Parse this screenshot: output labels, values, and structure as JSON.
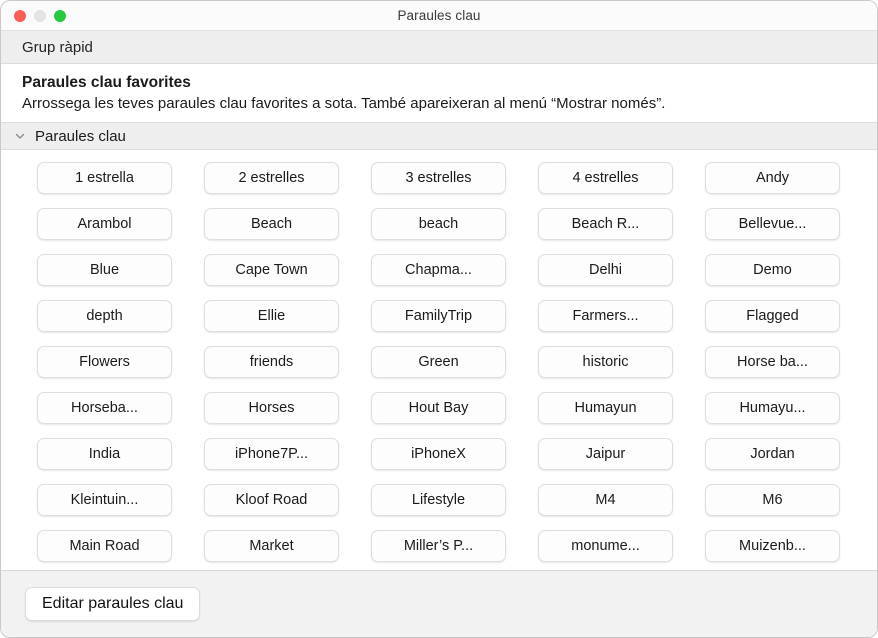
{
  "window": {
    "title": "Paraules clau",
    "traffic_lights": [
      {
        "name": "close",
        "color": "#ff5f57"
      },
      {
        "name": "minimize",
        "color": "#e4e4e4"
      },
      {
        "name": "zoom",
        "color": "#28c840"
      }
    ]
  },
  "quick_group": {
    "label": "Grup ràpid"
  },
  "favorites": {
    "title": "Paraules clau favorites",
    "description": "Arrossega les teves paraules clau favorites a sota. També apareixeran al menú “Mostrar només”."
  },
  "keywords_section": {
    "title": "Paraules clau",
    "disclosure_icon": "chevron-down-icon",
    "expanded": true,
    "columns": 5,
    "items": [
      "1 estrella",
      "2 estrelles",
      "3 estrelles",
      "4 estrelles",
      "Andy",
      "Arambol",
      "Beach",
      "beach",
      "Beach R...",
      "Bellevue...",
      "Blue",
      "Cape Town",
      "Chapma...",
      "Delhi",
      "Demo",
      "depth",
      "Ellie",
      "FamilyTrip",
      "Farmers...",
      "Flagged",
      "Flowers",
      "friends",
      "Green",
      "historic",
      "Horse ba...",
      "Horseba...",
      "Horses",
      "Hout Bay",
      "Humayun",
      "Humayu...",
      "India",
      "iPhone7P...",
      "iPhoneX",
      "Jaipur",
      "Jordan",
      "Kleintuin...",
      "Kloof Road",
      "Lifestyle",
      "M4",
      "M6",
      "Main Road",
      "Market",
      "Miller’s P...",
      "monume...",
      "Muizenb..."
    ]
  },
  "bottom_bar": {
    "edit_keywords_label": "Editar paraules clau"
  }
}
